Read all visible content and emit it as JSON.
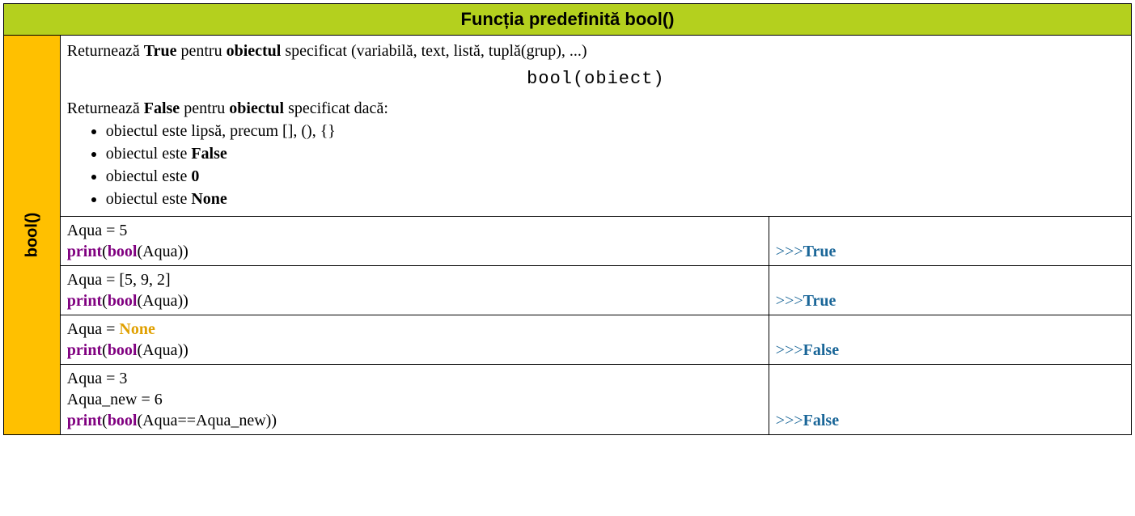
{
  "header": {
    "title": "Funcția predefinită bool()"
  },
  "sidebar": {
    "label": "bool()"
  },
  "description": {
    "line1_pre": "Returnează ",
    "line1_true": "True",
    "line1_mid": " pentru ",
    "line1_obj": "obiectul",
    "line1_post": " specificat (variabilă, text, listă, tuplă(grup), ...)",
    "syntax": "bool(obiect)",
    "line2_pre": "Returnează ",
    "line2_false": "False",
    "line2_mid": " pentru ",
    "line2_obj": "obiectul",
    "line2_post": " specificat dacă:",
    "bullets": {
      "b1": "obiectul este lipsă, precum [], (), {}",
      "b2_pre": "obiectul este ",
      "b2_bold": "False",
      "b3_pre": "obiectul este ",
      "b3_bold": "0",
      "b4_pre": "obiectul este ",
      "b4_bold": "None"
    }
  },
  "examples": [
    {
      "lines": [
        {
          "plain": "Aqua = 5"
        },
        {
          "print": "print",
          "open": "(",
          "bool": "bool",
          "inner": "(Aqua))",
          "close": ""
        }
      ],
      "prompt": ">>>",
      "output": "True"
    },
    {
      "lines": [
        {
          "plain": "Aqua = [5, 9, 2]"
        },
        {
          "print": "print",
          "open": "(",
          "bool": "bool",
          "inner": "(Aqua))",
          "close": ""
        }
      ],
      "prompt": ">>>",
      "output": "True"
    },
    {
      "lines": [
        {
          "plain_pre": "Aqua = ",
          "none": "None"
        },
        {
          "print": "print",
          "open": "(",
          "bool": "bool",
          "inner": "(Aqua))",
          "close": ""
        }
      ],
      "prompt": ">>>",
      "output": "False"
    },
    {
      "lines": [
        {
          "plain": "Aqua = 3"
        },
        {
          "plain": "Aqua_new = 6"
        },
        {
          "print": "print",
          "open": "(",
          "bool": "bool",
          "inner": "(Aqua==Aqua_new))",
          "close": ""
        }
      ],
      "prompt": ">>>",
      "output": "False"
    }
  ]
}
